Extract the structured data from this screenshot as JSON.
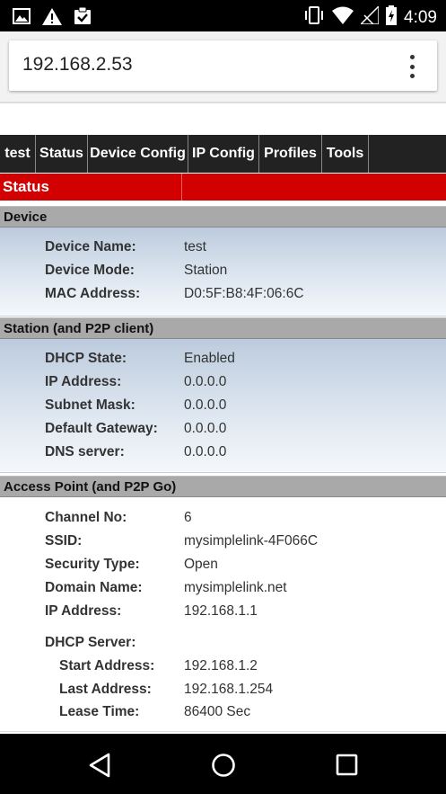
{
  "status_bar": {
    "time": "4:09"
  },
  "browser": {
    "url": "192.168.2.53"
  },
  "nav_tabs": [
    {
      "label": "test"
    },
    {
      "label": "Status"
    },
    {
      "label": "Device Config"
    },
    {
      "label": "IP Config"
    },
    {
      "label": "Profiles"
    },
    {
      "label": "Tools"
    }
  ],
  "page_title": "Status",
  "sections": {
    "device": {
      "title": "Device",
      "rows": [
        {
          "label": "Device Name:",
          "value": "test"
        },
        {
          "label": "Device Mode:",
          "value": "Station"
        },
        {
          "label": "MAC Address:",
          "value": "D0:5F:B8:4F:06:6C"
        }
      ]
    },
    "station": {
      "title": "Station (and P2P client)",
      "rows": [
        {
          "label": "DHCP State:",
          "value": "Enabled"
        },
        {
          "label": "IP Address:",
          "value": "0.0.0.0"
        },
        {
          "label": "Subnet Mask:",
          "value": "0.0.0.0"
        },
        {
          "label": "Default Gateway:",
          "value": "0.0.0.0"
        },
        {
          "label": "DNS server:",
          "value": "0.0.0.0"
        }
      ]
    },
    "ap": {
      "title": "Access Point (and P2P Go)",
      "rows": [
        {
          "label": "Channel No:",
          "value": "6"
        },
        {
          "label": "SSID:",
          "value": "mysimplelink-4F066C"
        },
        {
          "label": "Security Type:",
          "value": "Open"
        },
        {
          "label": "Domain Name:",
          "value": "mysimplelink.net"
        },
        {
          "label": "IP Address:",
          "value": "192.168.1.1"
        }
      ],
      "dhcp_server_label": "DHCP Server:",
      "dhcp_rows": [
        {
          "label": "Start Address:",
          "value": "192.168.1.2"
        },
        {
          "label": "Last Address:",
          "value": "192.168.1.254"
        },
        {
          "label": "Lease Time:",
          "value": "86400 Sec"
        }
      ]
    }
  },
  "icons": {
    "status_left": [
      "image-icon",
      "warning-icon",
      "clipboard-check-icon"
    ],
    "status_right": [
      "vibrate-icon",
      "wifi-icon",
      "signal-icon",
      "battery-charging-icon"
    ],
    "system_nav": [
      "back-icon",
      "home-icon",
      "recents-icon"
    ]
  },
  "colors": {
    "nav_bg": "#222222",
    "title_bar": "#d20000",
    "section_header": "#a9a9a9"
  }
}
